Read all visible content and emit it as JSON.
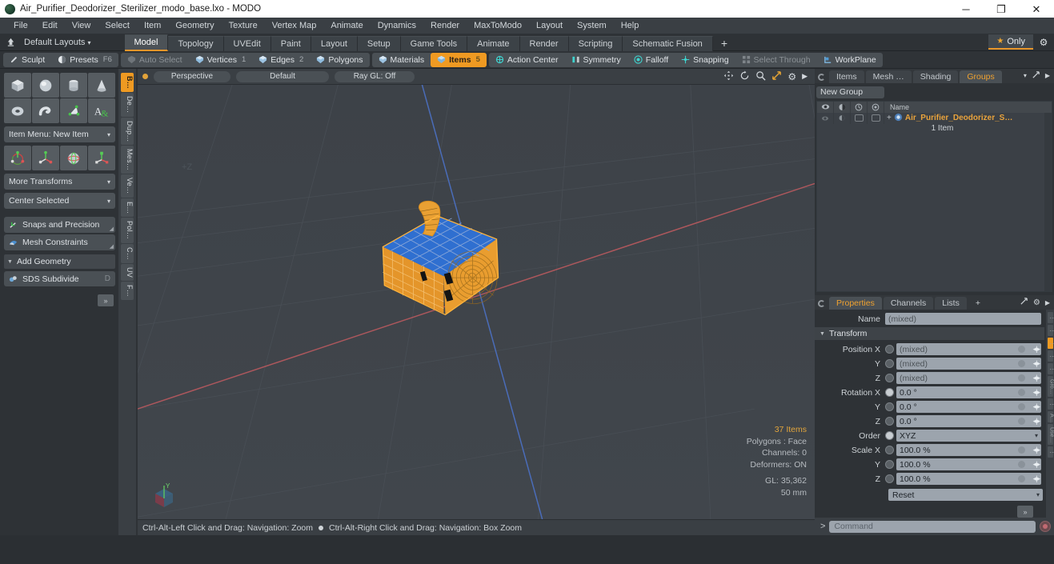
{
  "window": {
    "title": "Air_Purifier_Deodorizer_Sterilizer_modo_base.lxo - MODO",
    "minimize": "─",
    "maximize": "❐",
    "close": "✕"
  },
  "menubar": {
    "items": [
      "File",
      "Edit",
      "View",
      "Select",
      "Item",
      "Geometry",
      "Texture",
      "Vertex Map",
      "Animate",
      "Dynamics",
      "Render",
      "MaxToModo",
      "Layout",
      "System",
      "Help"
    ]
  },
  "layoutbar": {
    "default_layouts": "Default Layouts",
    "tabs": [
      "Model",
      "Topology",
      "UVEdit",
      "Paint",
      "Layout",
      "Setup",
      "Game Tools",
      "Animate",
      "Render",
      "Scripting",
      "Schematic Fusion"
    ],
    "active_tab": "Model",
    "plus": "+",
    "only_label": "Only"
  },
  "modebar": {
    "sculpt": "Sculpt",
    "presets": "Presets",
    "presets_key": "F6",
    "auto_select": "Auto Select",
    "vertices": "Vertices",
    "vertices_num": "1",
    "edges": "Edges",
    "edges_num": "2",
    "polygons": "Polygons",
    "materials": "Materials",
    "items": "Items",
    "items_num": "5",
    "action_center": "Action Center",
    "symmetry": "Symmetry",
    "falloff": "Falloff",
    "snapping": "Snapping",
    "select_through": "Select Through",
    "workplane": "WorkPlane"
  },
  "leftpanel": {
    "primitive_icons": [
      "cube-icon",
      "sphere-icon",
      "cylinder-icon",
      "cone-icon",
      "torus-icon",
      "capsule-icon",
      "teardrop-icon",
      "text-icon"
    ],
    "item_menu": "Item Menu: New Item",
    "transform_icons": [
      "transform-all-icon",
      "move-icon",
      "rotate-icon",
      "scale-icon"
    ],
    "more_transforms": "More Transforms",
    "center_selected": "Center Selected",
    "snaps_precision": "Snaps and Precision",
    "mesh_constraints": "Mesh Constraints",
    "add_geometry": "Add Geometry",
    "sds_subdivide": "SDS Subdivide",
    "sds_key": "D",
    "expand": "»",
    "vtabs": [
      "B…",
      "De…",
      "Dup…",
      "Mes…",
      "Ve…",
      "E…",
      "Pol…",
      "C…",
      "UV",
      "F…"
    ],
    "vtab_active": "B…"
  },
  "viewport": {
    "perspective": "Perspective",
    "shading": "Default",
    "raygl": "Ray GL: Off",
    "nav_icons": [
      "pan-icon",
      "rotate-icon",
      "zoom-icon",
      "fit-icon",
      "viewport-settings-icon",
      "expand-arrow-icon"
    ],
    "axis_label": "+Z",
    "stats": {
      "items": "37 Items",
      "polygons": "Polygons : Face",
      "channels": "Channels: 0",
      "deformers": "Deformers: ON",
      "gl": "GL: 35,362",
      "scale": "50 mm"
    },
    "status_left": "Ctrl-Alt-Left Click and Drag: Navigation: Zoom",
    "status_right": "Ctrl-Alt-Right Click and Drag: Navigation: Box Zoom"
  },
  "rightpanel": {
    "tabs": [
      "Items",
      "Mesh …",
      "Shading",
      "Groups"
    ],
    "active_tab": "Groups",
    "new_group": "New Group",
    "tree_header_name": "Name",
    "tree_header_icons": [
      "eye-icon",
      "render-icon",
      "lock-icon",
      "ghost-icon"
    ],
    "item_name": "Air_Purifier_Deodorizer_S…",
    "item_count": "1 Item",
    "expand_plus": "+"
  },
  "properties": {
    "tabs": [
      "Properties",
      "Channels",
      "Lists"
    ],
    "active_tab": "Properties",
    "add_tab": "+",
    "name_label": "Name",
    "name_value": "(mixed)",
    "transform_section": "Transform",
    "rows": [
      {
        "label": "Position X",
        "value": "(mixed)",
        "dim": true,
        "knob": false
      },
      {
        "label": "Y",
        "value": "(mixed)",
        "dim": true,
        "knob": false
      },
      {
        "label": "Z",
        "value": "(mixed)",
        "dim": true,
        "knob": false
      },
      {
        "label": "Rotation X",
        "value": "0.0 °",
        "dim": false,
        "knob": true
      },
      {
        "label": "Y",
        "value": "0.0 °",
        "dim": false,
        "knob": false
      },
      {
        "label": "Z",
        "value": "0.0 °",
        "dim": false,
        "knob": false
      }
    ],
    "order_label": "Order",
    "order_value": "XYZ",
    "scale_rows": [
      {
        "label": "Scale X",
        "value": "100.0 %"
      },
      {
        "label": "Y",
        "value": "100.0 %"
      },
      {
        "label": "Z",
        "value": "100.0 %"
      }
    ],
    "reset": "Reset",
    "expand": "»",
    "vtabs": [
      "⋮",
      "⋮",
      "⋮",
      "⋮",
      "⋮",
      "Gro…",
      "⋮",
      "A…",
      "Use…",
      "⋮"
    ]
  },
  "commandbar": {
    "prompt": ">",
    "placeholder": "Command",
    "record_icon": "record-icon"
  },
  "colors": {
    "accent_orange": "#ef9a22",
    "selection_orange": "#f0a230",
    "mesh_blue": "#2b6fd4",
    "panel_bg": "#2e3236",
    "viewport_bg": "#3f444a"
  }
}
